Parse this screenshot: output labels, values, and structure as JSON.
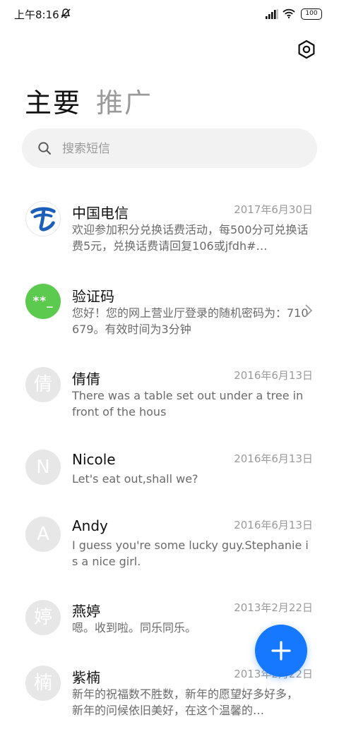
{
  "status_bar": {
    "time": "上午8:16",
    "battery": "100"
  },
  "tabs": {
    "main": "主要",
    "promo": "推广"
  },
  "search": {
    "placeholder": "搜索短信"
  },
  "conversations": [
    {
      "name": "中国电信",
      "date": "2017年6月30日",
      "preview": "欢迎参加积分兑换话费活动，每500分可兑换话费5元，兑换话费请回复106或jfdh#…",
      "avatar": "telecom-logo"
    },
    {
      "name": "验证码",
      "date": "",
      "preview": "您好！您的网上营业厅登录的随机密码为：710679。有效时间为3分钟",
      "avatar_text": "**_"
    },
    {
      "name": "倩倩",
      "date": "2016年6月13日",
      "preview": "There was a table set out under a tree in front of the hous",
      "avatar_text": "倩"
    },
    {
      "name": "Nicole",
      "date": "2016年6月13日",
      "preview": "Let's eat out,shall we?",
      "avatar_text": "N"
    },
    {
      "name": "Andy",
      "date": "2016年6月13日",
      "preview": "I guess you're some lucky guy.Stephanie is a nice girl.",
      "avatar_text": "A"
    },
    {
      "name": "燕婷",
      "date": "2013年2月22日",
      "preview": "嗯。收到啦。同乐同乐。",
      "avatar_text": "婷"
    },
    {
      "name": "紫楠",
      "date": "2013年2月22日",
      "preview": "新年的祝福数不胜数，新年的愿望好多好多，新年的问候依旧美好，在这个温馨的…",
      "avatar_text": "楠"
    }
  ],
  "colors": {
    "accent": "#1677ff",
    "verify_avatar": "#5cc94f",
    "avatar_gray": "#e7e7e7",
    "secondary_text": "#9a9a9a"
  },
  "icons": {
    "settings": "hexagon-gear-icon",
    "search": "search-icon",
    "fab": "plus-icon",
    "chevron": "chevron-right-icon"
  }
}
